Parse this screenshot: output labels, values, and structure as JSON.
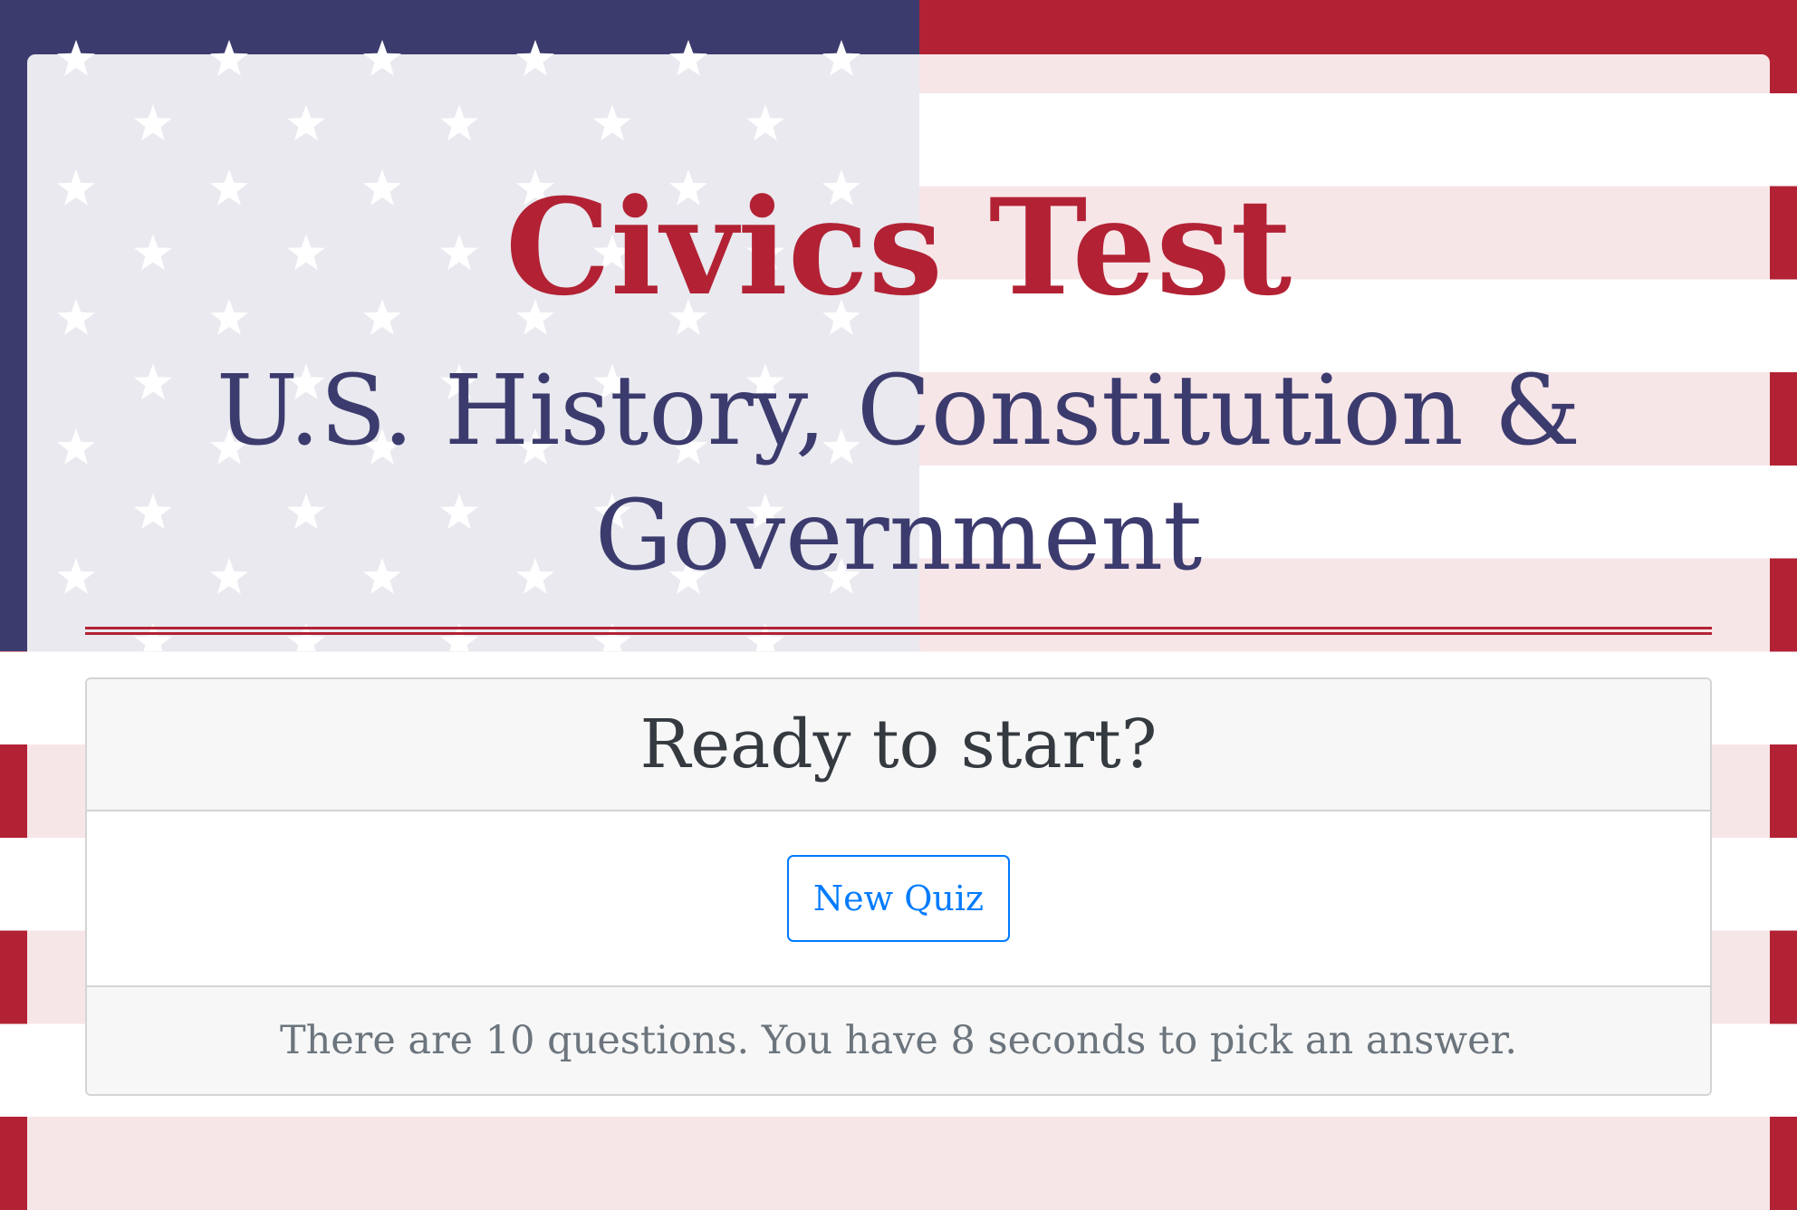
{
  "page": {
    "title": "Civics Test",
    "subtitle": "U.S. History, Constitution & Government"
  },
  "start_card": {
    "heading": "Ready to start?",
    "new_quiz_label": "New Quiz",
    "info_text": "There are 10 questions. You have 8 seconds to pick an answer."
  },
  "theme": {
    "flag_red": "#b22234",
    "flag_blue": "#3c3b6e",
    "button_blue": "#007bff",
    "background_icon": "american-flag"
  }
}
